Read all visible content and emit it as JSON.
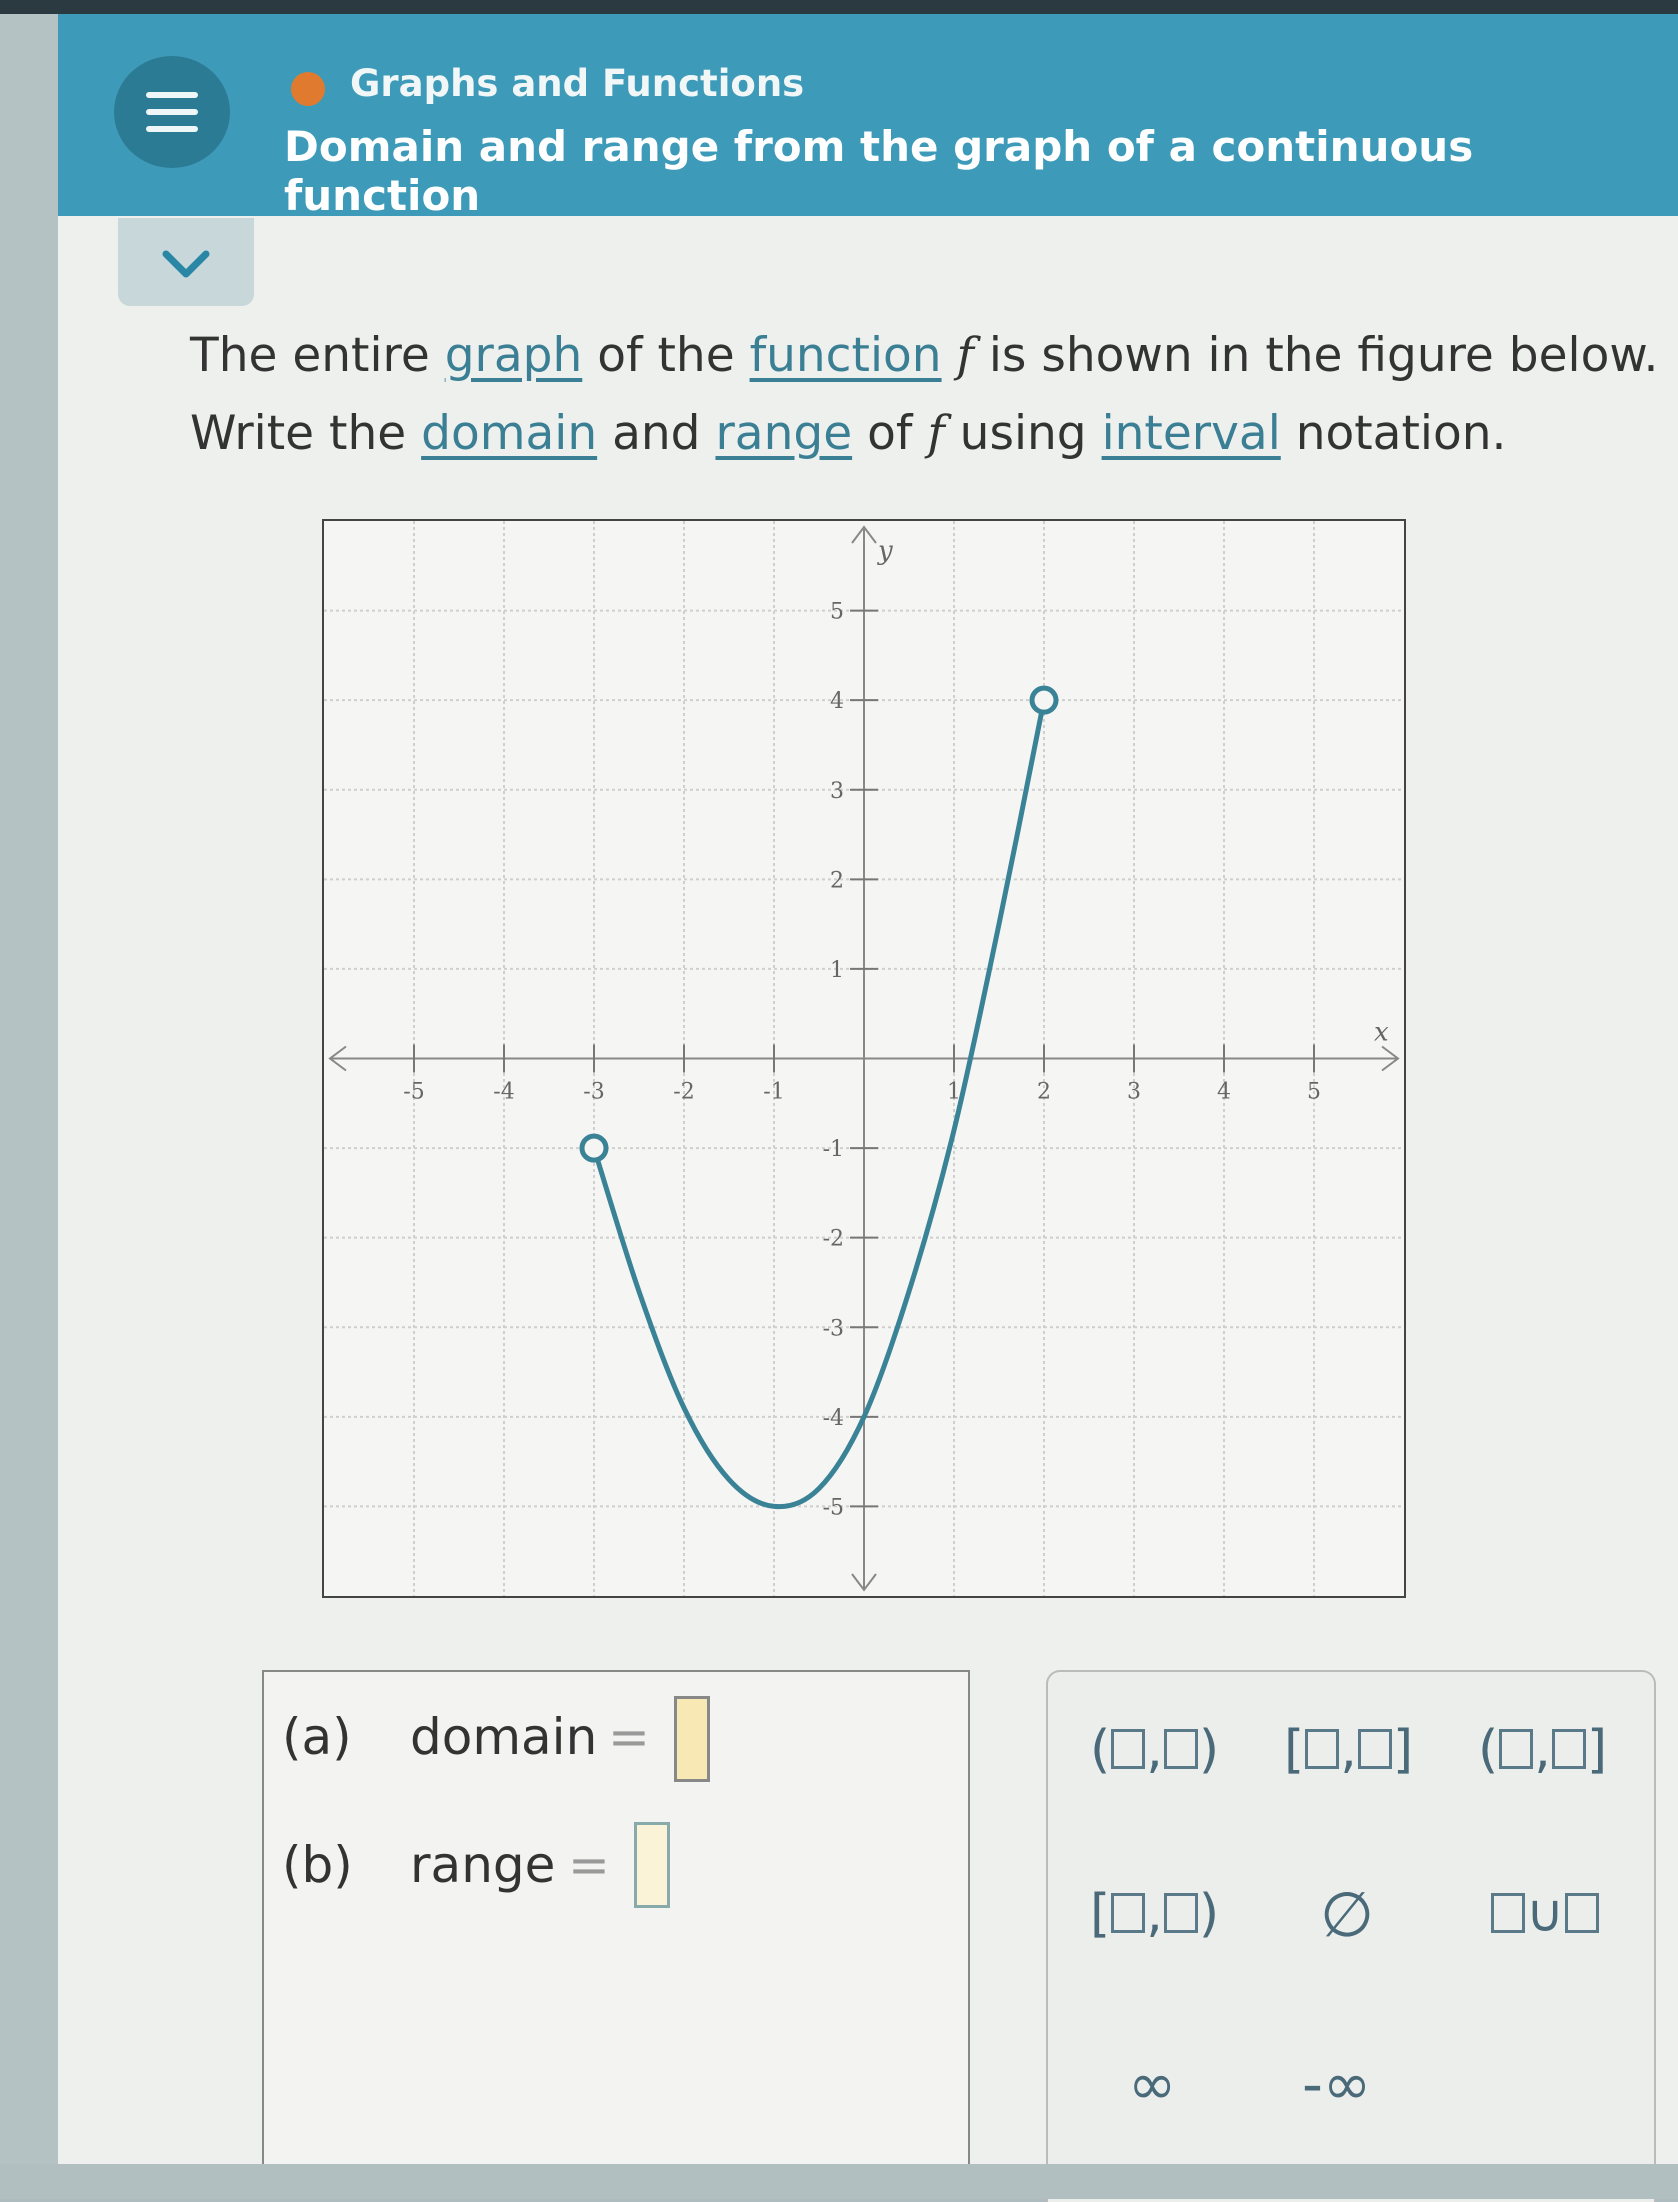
{
  "header": {
    "topic": "Graphs and Functions",
    "title": "Domain and range from the graph of a continuous function"
  },
  "problem": {
    "line1_a": "The entire ",
    "line1_link1": "graph",
    "line1_b": " of the ",
    "line1_link2": "function",
    "line1_var": "f",
    "line1_c": "is shown in the figure below.",
    "line2_a": "Write the ",
    "line2_link1": "domain",
    "line2_b": " and ",
    "line2_link2": "range",
    "line2_c": " of ",
    "line2_var": "f",
    "line2_d": "using ",
    "line2_link3": "interval",
    "line2_e": " notation."
  },
  "chart_data": {
    "type": "line",
    "xlabel": "x",
    "ylabel": "y",
    "xlim": [
      -6,
      6
    ],
    "ylim": [
      -6,
      6
    ],
    "x_ticks": [
      "-5",
      "-4",
      "-3",
      "-2",
      "-1",
      "1",
      "2",
      "3",
      "4",
      "5"
    ],
    "y_ticks": [
      "5",
      "4",
      "3",
      "2",
      "1",
      "-1",
      "-2",
      "-3",
      "-4",
      "-5"
    ],
    "grid": true,
    "series": [
      {
        "x": [
          -3,
          -2.5,
          -2,
          -1.5,
          -1,
          -0.5,
          0,
          0.5,
          1,
          1.5,
          2
        ],
        "y": [
          -1,
          -2.6,
          -3.9,
          -4.7,
          -5,
          -4.8,
          -4,
          -2.6,
          -0.8,
          1.5,
          4
        ]
      }
    ],
    "endpoints": [
      {
        "x": -3,
        "y": -1,
        "open": true
      },
      {
        "x": 2,
        "y": 4,
        "open": true
      }
    ],
    "color": "#3a8296"
  },
  "answers": {
    "a_label": "(a)",
    "a_text": "domain",
    "b_label": "(b)",
    "b_text": "range",
    "equals": "="
  },
  "keypad": {
    "k1_open": "(",
    "k1_close": ")",
    "k2_open": "[",
    "k2_close": "]",
    "k3_open": "(",
    "k3_close": "]",
    "k4_open": "[",
    "k4_close": ")",
    "comma": ",",
    "empty_set": "∅",
    "union": "∪",
    "infinity": "∞",
    "neg_infinity": "-∞"
  }
}
